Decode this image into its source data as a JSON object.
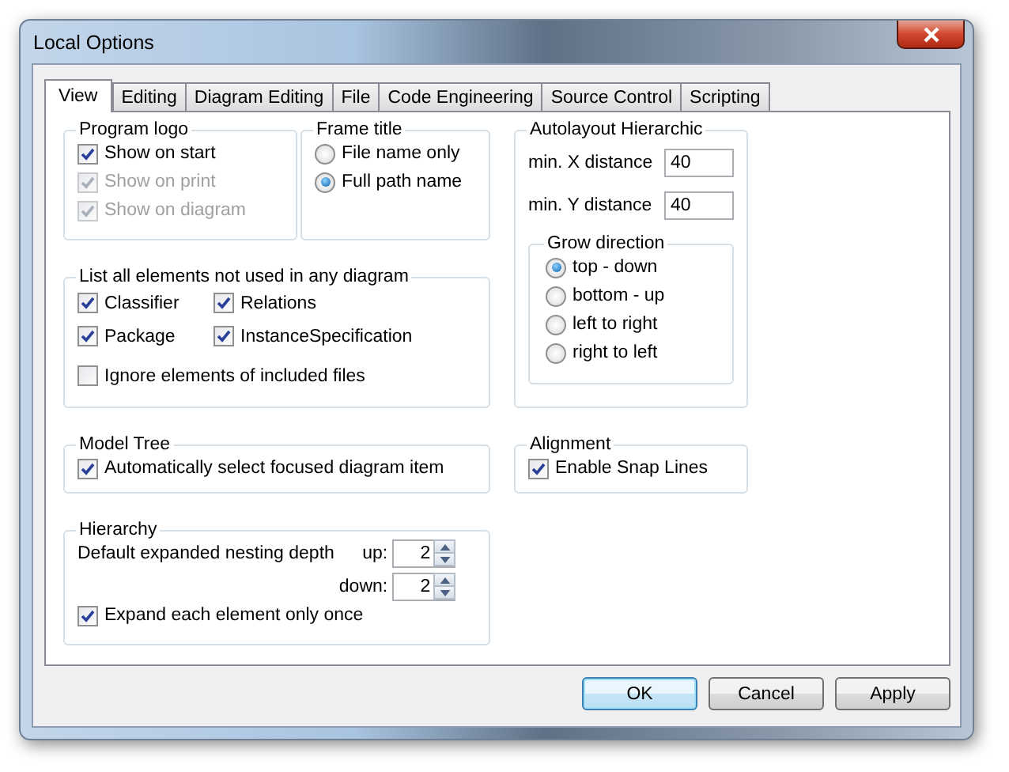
{
  "window": {
    "title": "Local Options"
  },
  "tabs": [
    {
      "label": "View",
      "selected": true
    },
    {
      "label": "Editing",
      "selected": false
    },
    {
      "label": "Diagram Editing",
      "selected": false
    },
    {
      "label": "File",
      "selected": false
    },
    {
      "label": "Code Engineering",
      "selected": false
    },
    {
      "label": "Source Control",
      "selected": false
    },
    {
      "label": "Scripting",
      "selected": false
    }
  ],
  "program_logo": {
    "title": "Program logo",
    "options": [
      {
        "label": "Show on start",
        "checked": true,
        "disabled": false
      },
      {
        "label": "Show on print",
        "checked": true,
        "disabled": true
      },
      {
        "label": "Show on diagram",
        "checked": true,
        "disabled": true
      }
    ]
  },
  "frame_title": {
    "title": "Frame title",
    "options": [
      {
        "label": "File name only",
        "selected": false
      },
      {
        "label": "Full path name",
        "selected": true
      }
    ]
  },
  "unused_elements": {
    "title": "List all elements not used in any diagram",
    "rows": [
      [
        {
          "label": "Classifier",
          "checked": true
        },
        {
          "label": "Relations",
          "checked": true
        }
      ],
      [
        {
          "label": "Package",
          "checked": true
        },
        {
          "label": "InstanceSpecification",
          "checked": true
        }
      ],
      [
        {
          "label": "Ignore elements of included files",
          "checked": false
        }
      ]
    ]
  },
  "autolayout": {
    "title": "Autolayout Hierarchic",
    "fields": [
      {
        "label": "min. X distance",
        "value": "40"
      },
      {
        "label": "min. Y distance",
        "value": "40"
      }
    ],
    "grow_direction": {
      "title": "Grow direction",
      "options": [
        {
          "label": "top - down",
          "selected": true
        },
        {
          "label": "bottom - up",
          "selected": false
        },
        {
          "label": "left to right",
          "selected": false
        },
        {
          "label": "right to left",
          "selected": false
        }
      ]
    }
  },
  "model_tree": {
    "title": "Model Tree",
    "options": [
      {
        "label": "Automatically select focused diagram item",
        "checked": true
      }
    ]
  },
  "alignment": {
    "title": "Alignment",
    "options": [
      {
        "label": "Enable Snap Lines",
        "checked": true
      }
    ]
  },
  "hierarchy": {
    "title": "Hierarchy",
    "label": "Default expanded nesting depth",
    "spinners": [
      {
        "label": "up:",
        "value": "2"
      },
      {
        "label": "down:",
        "value": "2"
      }
    ],
    "options": [
      {
        "label": "Expand each element only once",
        "checked": true
      }
    ]
  },
  "buttons": [
    {
      "label": "OK",
      "default": true
    },
    {
      "label": "Cancel",
      "default": false
    },
    {
      "label": "Apply",
      "default": false
    }
  ]
}
